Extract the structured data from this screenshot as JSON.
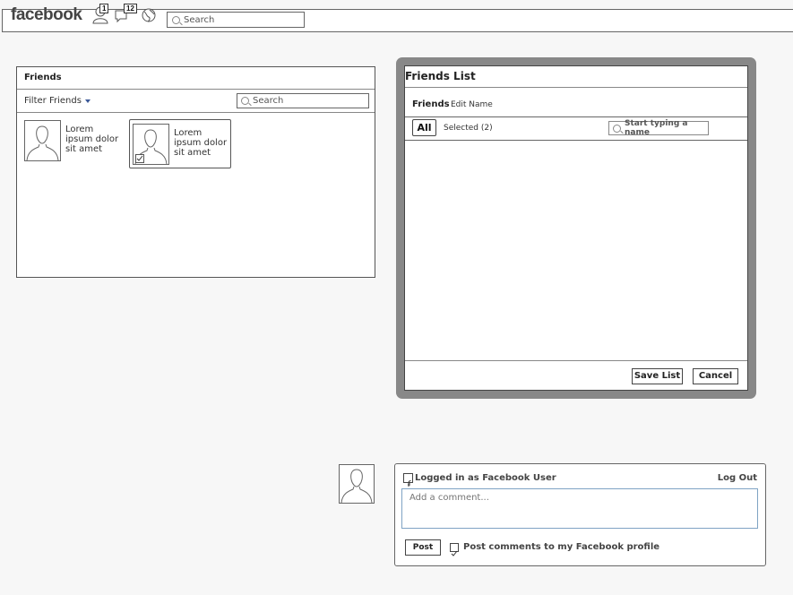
{
  "header": {
    "logo": "facebook",
    "friend_requests_count": "1",
    "messages_count": "12",
    "search_placeholder": "Search"
  },
  "friends_panel": {
    "title": "Friends",
    "filter_label": "Filter Friends",
    "search_placeholder": "Search",
    "friends": [
      {
        "name": "Lorem ipsum dolor sit amet",
        "selected": false
      },
      {
        "name": "Lorem ipsum dolor sit amet",
        "selected": true
      }
    ]
  },
  "friends_list_dialog": {
    "title": "Friends List",
    "list_name": "Friends",
    "edit_name_label": "Edit Name",
    "tab_all": "All",
    "tab_selected": "Selected (2)",
    "name_search_placeholder": "Start typing a name",
    "save_label": "Save List",
    "cancel_label": "Cancel"
  },
  "comment_section": {
    "logged_in_text": "Logged in as Facebook User",
    "logout_label": "Log Out",
    "comment_placeholder": "Add a comment...",
    "post_label": "Post",
    "post_to_profile_label": "Post comments to my Facebook profile",
    "post_to_profile_checked": true
  },
  "colors": {
    "accent": "#3b5998",
    "dialog_frame": "#888888",
    "comment_border": "#7fa3c4"
  }
}
